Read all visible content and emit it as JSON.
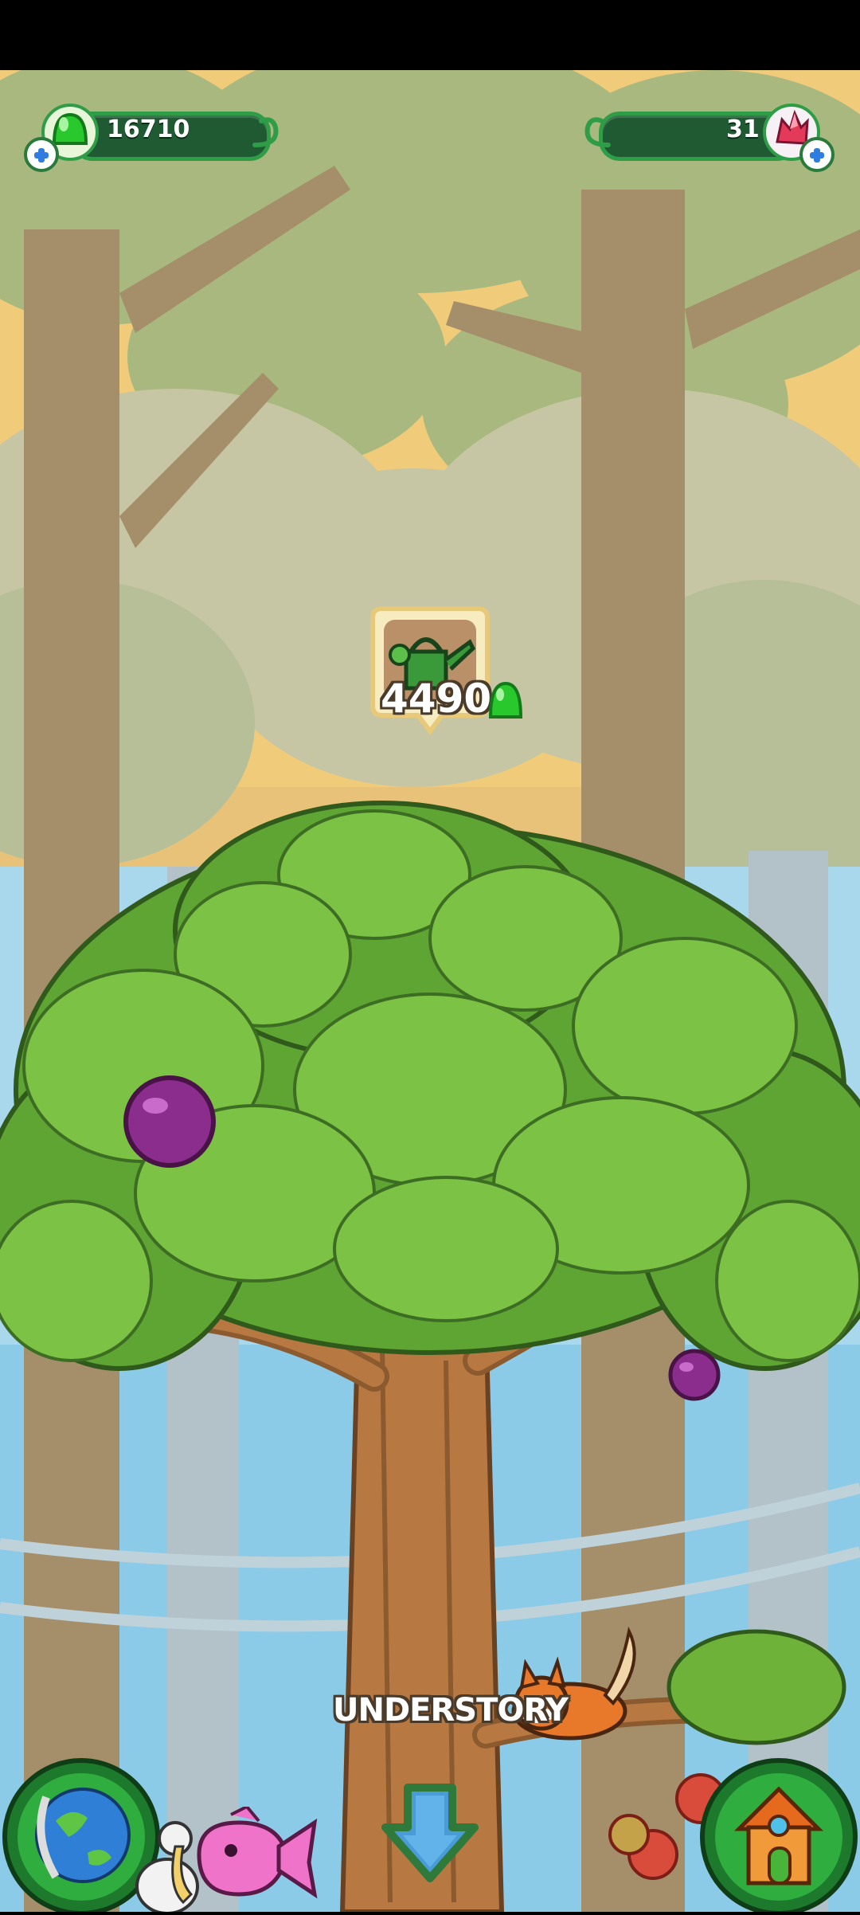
{
  "hud": {
    "gems_left": {
      "value": "16710",
      "icon": "green-gem-icon",
      "add_icon": "plus-icon"
    },
    "gems_right": {
      "value": "31",
      "icon": "red-crystal-icon",
      "add_icon": "plus-icon"
    }
  },
  "upgrade_bubble": {
    "icon": "watering-can-icon",
    "cost": "4490",
    "currency_icon": "green-gem-icon"
  },
  "layer_label": "UNDERSTORY",
  "bottom_bar": {
    "left_button_icon": "globe-icon",
    "center_button_icon": "down-arrow-icon",
    "right_button_icon": "house-icon"
  },
  "colors": {
    "hud_green": "#2f9d48",
    "hud_dark": "#1f5a33",
    "leaf_green": "#7cc245",
    "trunk_brown": "#b77842",
    "sky_yellow": "#f2cf7a",
    "water_blue": "#7ec6e8"
  }
}
